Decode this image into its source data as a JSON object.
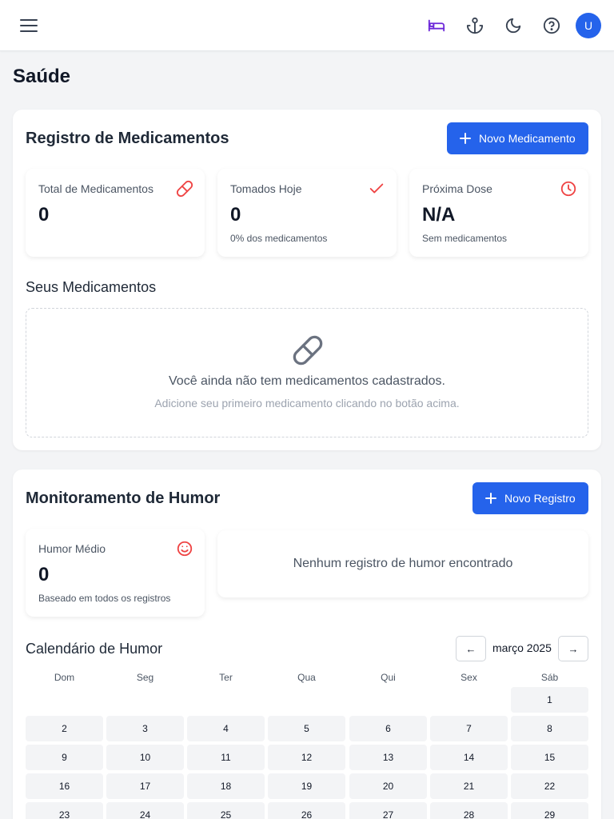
{
  "header": {
    "avatar_initial": "U",
    "icons": [
      "menu-icon",
      "bed-icon",
      "anchor-icon",
      "moon-icon",
      "help-icon"
    ],
    "accent": "#6d28d9"
  },
  "page_title": "Saúde",
  "medications": {
    "title": "Registro de Medicamentos",
    "new_button": "Novo Medicamento",
    "stats": [
      {
        "label": "Total de Medicamentos",
        "value": "0",
        "sub": "",
        "icon": "pill-icon",
        "color": "#ef4444"
      },
      {
        "label": "Tomados Hoje",
        "value": "0",
        "sub": "0% dos medicamentos",
        "icon": "check-icon",
        "color": "#ef4444"
      },
      {
        "label": "Próxima Dose",
        "value": "N/A",
        "sub": "Sem medicamentos",
        "icon": "clock-icon",
        "color": "#ef4444"
      }
    ],
    "list_title": "Seus Medicamentos",
    "empty_title": "Você ainda não tem medicamentos cadastrados.",
    "empty_hint": "Adicione seu primeiro medicamento clicando no botão acima."
  },
  "mood": {
    "title": "Monitoramento de Humor",
    "new_button": "Novo Registro",
    "stat": {
      "label": "Humor Médio",
      "value": "0",
      "sub": "Baseado em todos os registros",
      "icon": "smile-icon",
      "color": "#ef4444"
    },
    "empty_text": "Nenhum registro de humor encontrado",
    "calendar": {
      "title": "Calendário de Humor",
      "prev": "←",
      "next": "→",
      "month": "março 2025",
      "weekdays": [
        "Dom",
        "Seg",
        "Ter",
        "Qua",
        "Qui",
        "Sex",
        "Sáb"
      ],
      "first_weekday_index": 6,
      "days": [
        "1",
        "2",
        "3",
        "4",
        "5",
        "6",
        "7",
        "8",
        "9",
        "10",
        "11",
        "12",
        "13",
        "14",
        "15",
        "16",
        "17",
        "18",
        "19",
        "20",
        "21",
        "22",
        "23",
        "24",
        "25",
        "26",
        "27",
        "28",
        "29"
      ]
    }
  },
  "colors": {
    "primary": "#2563eb",
    "icon_red": "#ef4444"
  }
}
